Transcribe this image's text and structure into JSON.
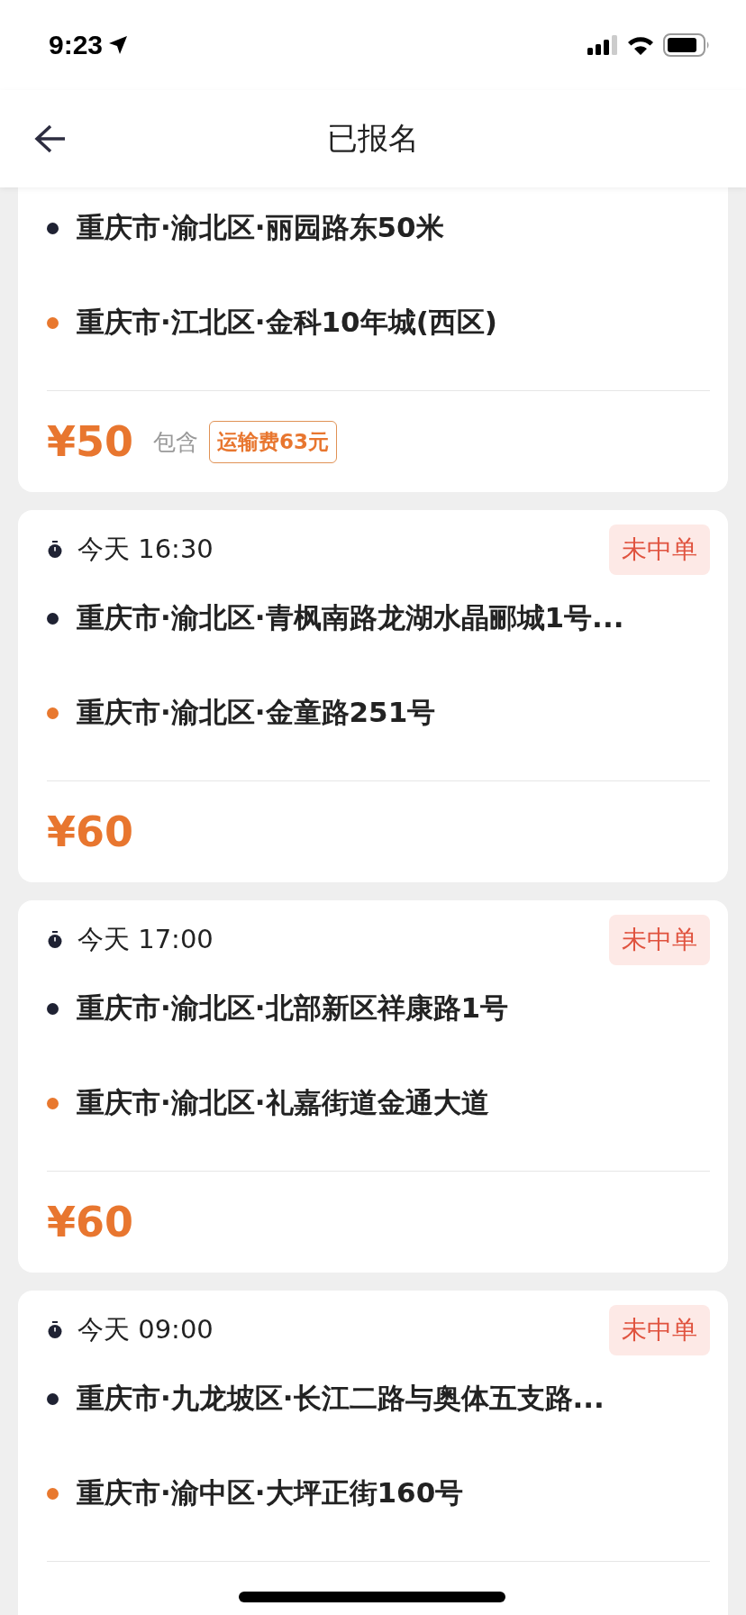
{
  "status_bar": {
    "time": "9:23"
  },
  "nav": {
    "title": "已报名"
  },
  "orders": [
    {
      "from": "重庆市·渝北区·丽园路东50米",
      "to": "重庆市·江北区·金科10年城(西区)",
      "price": "¥50",
      "includes_label": "包含",
      "fee": "运输费63元"
    },
    {
      "time": "今天 16:30",
      "status": "未中单",
      "from": "重庆市·渝北区·青枫南路龙湖水晶郦城1号...",
      "to": "重庆市·渝北区·金童路251号",
      "price": "¥60"
    },
    {
      "time": "今天 17:00",
      "status": "未中单",
      "from": "重庆市·渝北区·北部新区祥康路1号",
      "to": "重庆市·渝北区·礼嘉街道金通大道",
      "price": "¥60"
    },
    {
      "time": "今天 09:00",
      "status": "未中单",
      "from": "重庆市·九龙坡区·长江二路与奥体五支路...",
      "to": "重庆市·渝中区·大坪正街160号"
    }
  ]
}
